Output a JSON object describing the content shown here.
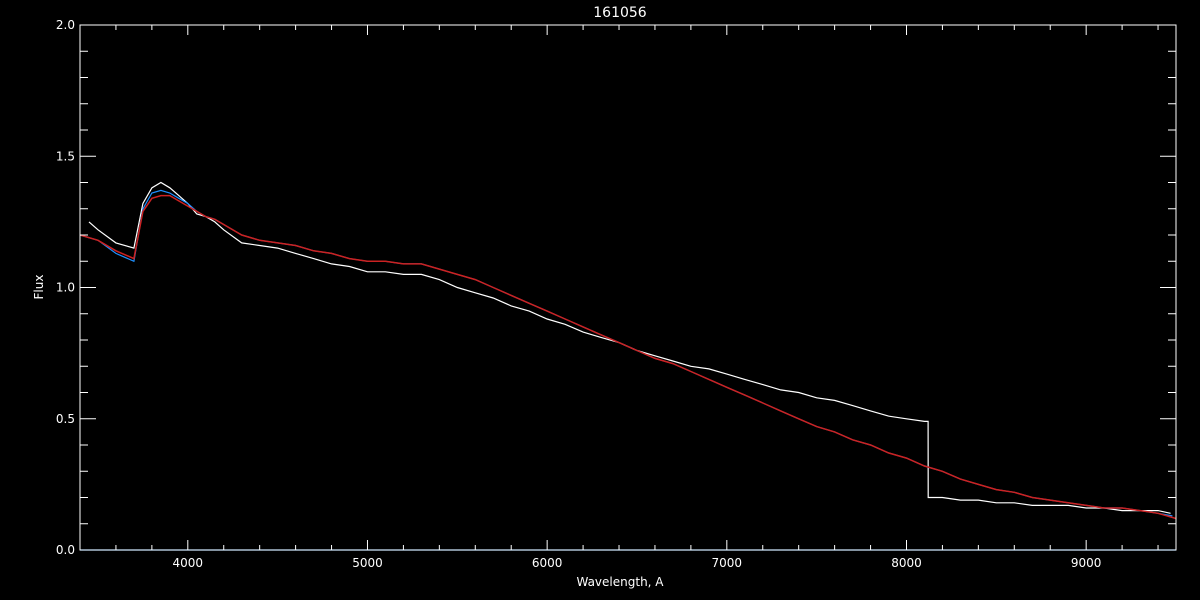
{
  "chart_data": {
    "type": "line",
    "title": "161056",
    "xlabel": "Wavelength, A",
    "ylabel": "Flux",
    "xlim": [
      3400,
      9500
    ],
    "ylim": [
      0.0,
      2.0
    ],
    "x_ticks": [
      4000,
      5000,
      6000,
      7000,
      8000,
      9000
    ],
    "x_tick_labels": [
      "4000",
      "5000",
      "6000",
      "7000",
      "8000",
      "9000"
    ],
    "y_ticks": [
      0.0,
      0.5,
      1.0,
      1.5,
      2.0
    ],
    "y_tick_labels": [
      "0.0",
      "0.5",
      "1.0",
      "1.5",
      "2.0"
    ],
    "grid": false,
    "background": "#000000",
    "series": [
      {
        "color": "#ffffff",
        "x": [
          3450,
          3500,
          3600,
          3700,
          3750,
          3800,
          3850,
          3900,
          3950,
          4000,
          4050,
          4100,
          4150,
          4200,
          4300,
          4400,
          4500,
          4600,
          4700,
          4800,
          4900,
          5000,
          5100,
          5200,
          5300,
          5400,
          5500,
          5600,
          5700,
          5800,
          5900,
          6000,
          6100,
          6200,
          6300,
          6400,
          6500,
          6600,
          6700,
          6800,
          6900,
          7000,
          7100,
          7200,
          7300,
          7400,
          7500,
          7600,
          7700,
          7800,
          7900,
          8000,
          8100,
          8120,
          8121,
          8200,
          8300,
          8400,
          8500,
          8600,
          8700,
          8800,
          8900,
          9000,
          9100,
          9200,
          9300,
          9400,
          9470
        ],
        "values": [
          1.25,
          1.22,
          1.17,
          1.15,
          1.32,
          1.38,
          1.4,
          1.38,
          1.35,
          1.32,
          1.28,
          1.27,
          1.25,
          1.22,
          1.17,
          1.16,
          1.15,
          1.13,
          1.11,
          1.09,
          1.08,
          1.06,
          1.06,
          1.05,
          1.05,
          1.03,
          1.0,
          0.98,
          0.96,
          0.93,
          0.91,
          0.88,
          0.86,
          0.83,
          0.81,
          0.79,
          0.76,
          0.74,
          0.72,
          0.7,
          0.69,
          0.67,
          0.65,
          0.63,
          0.61,
          0.6,
          0.58,
          0.57,
          0.55,
          0.53,
          0.51,
          0.5,
          0.49,
          0.49,
          0.2,
          0.2,
          0.19,
          0.19,
          0.18,
          0.18,
          0.17,
          0.17,
          0.17,
          0.16,
          0.16,
          0.15,
          0.15,
          0.15,
          0.14
        ]
      },
      {
        "color": "#1e90ff",
        "x": [
          3400,
          3500,
          3600,
          3700,
          3750,
          3800,
          3850,
          3900,
          3950,
          4000,
          4050,
          4100,
          4150,
          4200,
          4300,
          4400,
          4500,
          4600,
          4700,
          4800,
          4900,
          5000,
          5100,
          5200,
          5300,
          5400,
          5500,
          5600,
          5700,
          5800,
          5900,
          6000,
          6100,
          6200,
          6300,
          6400,
          6500,
          6600,
          6700,
          6800,
          6900,
          7000,
          7100,
          7200,
          7300,
          7400,
          7500,
          7600,
          7700,
          7800,
          7900,
          8000,
          8100,
          8200,
          8300,
          8400,
          8500,
          8600,
          8700,
          8800,
          8900,
          9000,
          9100,
          9200,
          9300,
          9400,
          9480
        ],
        "values": [
          1.2,
          1.18,
          1.13,
          1.1,
          1.3,
          1.36,
          1.37,
          1.36,
          1.34,
          1.32,
          1.29,
          1.27,
          1.26,
          1.24,
          1.2,
          1.18,
          1.17,
          1.16,
          1.14,
          1.13,
          1.11,
          1.1,
          1.1,
          1.09,
          1.09,
          1.07,
          1.05,
          1.03,
          1.0,
          0.97,
          0.94,
          0.91,
          0.88,
          0.85,
          0.82,
          0.79,
          0.76,
          0.73,
          0.71,
          0.68,
          0.65,
          0.62,
          0.59,
          0.56,
          0.53,
          0.5,
          0.47,
          0.45,
          0.42,
          0.4,
          0.37,
          0.35,
          0.32,
          0.3,
          0.27,
          0.25,
          0.23,
          0.22,
          0.2,
          0.19,
          0.18,
          0.17,
          0.16,
          0.16,
          0.15,
          0.14,
          0.13
        ]
      },
      {
        "color": "#cc2222",
        "x": [
          3400,
          3500,
          3600,
          3700,
          3750,
          3800,
          3850,
          3900,
          3950,
          4000,
          4050,
          4100,
          4150,
          4200,
          4300,
          4400,
          4500,
          4600,
          4700,
          4800,
          4900,
          5000,
          5100,
          5200,
          5300,
          5400,
          5500,
          5600,
          5700,
          5800,
          5900,
          6000,
          6100,
          6200,
          6300,
          6400,
          6500,
          6600,
          6700,
          6800,
          6900,
          7000,
          7100,
          7200,
          7300,
          7400,
          7500,
          7600,
          7700,
          7800,
          7900,
          8000,
          8100,
          8200,
          8300,
          8400,
          8500,
          8600,
          8700,
          8800,
          8900,
          9000,
          9100,
          9200,
          9300,
          9400,
          9500
        ],
        "values": [
          1.2,
          1.18,
          1.14,
          1.11,
          1.29,
          1.34,
          1.35,
          1.35,
          1.33,
          1.31,
          1.29,
          1.27,
          1.26,
          1.24,
          1.2,
          1.18,
          1.17,
          1.16,
          1.14,
          1.13,
          1.11,
          1.1,
          1.1,
          1.09,
          1.09,
          1.07,
          1.05,
          1.03,
          1.0,
          0.97,
          0.94,
          0.91,
          0.88,
          0.85,
          0.82,
          0.79,
          0.76,
          0.73,
          0.71,
          0.68,
          0.65,
          0.62,
          0.59,
          0.56,
          0.53,
          0.5,
          0.47,
          0.45,
          0.42,
          0.4,
          0.37,
          0.35,
          0.32,
          0.3,
          0.27,
          0.25,
          0.23,
          0.22,
          0.2,
          0.19,
          0.18,
          0.17,
          0.16,
          0.16,
          0.15,
          0.14,
          0.12
        ]
      },
      {
        "color": "#1e90ff",
        "x": [
          3400,
          9500
        ],
        "values": [
          0.0,
          0.0
        ]
      }
    ]
  }
}
